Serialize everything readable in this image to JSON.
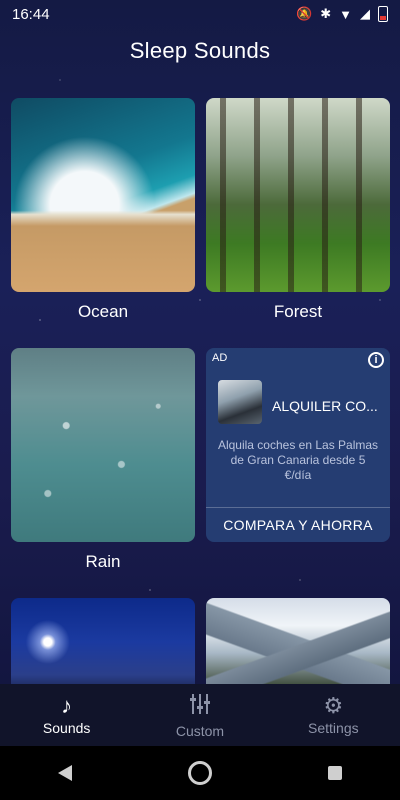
{
  "status": {
    "time": "16:44",
    "icons": [
      "mute-icon",
      "bluetooth-icon",
      "wifi-icon",
      "signal-icon",
      "battery-icon"
    ]
  },
  "title": "Sleep Sounds",
  "cards": [
    {
      "label": "Ocean"
    },
    {
      "label": "Forest"
    },
    {
      "label": "Rain"
    }
  ],
  "ad": {
    "tag": "AD",
    "title": "ALQUILER CO...",
    "description": "Alquila coches en Las Palmas de Gran Canaria desde 5 €/día",
    "cta": "COMPARA Y AHORRA"
  },
  "tabs": [
    {
      "label": "Sounds",
      "icon": "music-note-icon",
      "active": true
    },
    {
      "label": "Custom",
      "icon": "sliders-icon",
      "active": false
    },
    {
      "label": "Settings",
      "icon": "gear-icon",
      "active": false
    }
  ]
}
